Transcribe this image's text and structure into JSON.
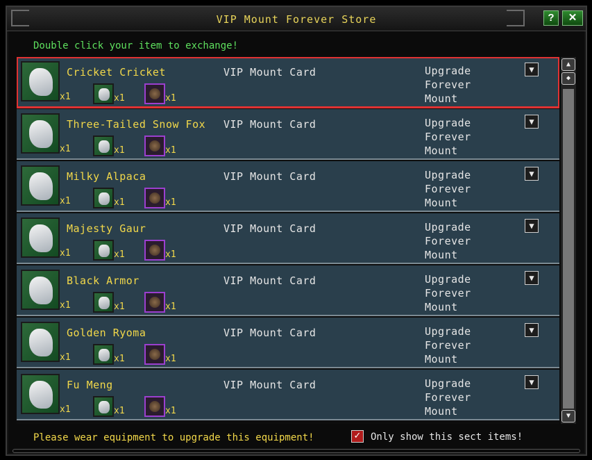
{
  "window": {
    "title": "VIP Mount Forever Store",
    "help_label": "?",
    "close_label": "✕"
  },
  "instruction": "Double click your item to exchange!",
  "rows": [
    {
      "name": "Cricket Cricket",
      "card": "VIP Mount Card",
      "action_line1": "Upgrade Forever",
      "action_line2": "Mount",
      "qty_main": "x1",
      "qty_mount": "x1",
      "qty_card": "x1",
      "selected": true
    },
    {
      "name": "Three-Tailed Snow Fox",
      "card": "VIP Mount Card",
      "action_line1": "Upgrade Forever",
      "action_line2": "Mount",
      "qty_main": "x1",
      "qty_mount": "x1",
      "qty_card": "x1"
    },
    {
      "name": "Milky Alpaca",
      "card": "VIP Mount Card",
      "action_line1": "Upgrade Forever",
      "action_line2": "Mount",
      "qty_main": "x1",
      "qty_mount": "x1",
      "qty_card": "x1"
    },
    {
      "name": "Majesty Gaur",
      "card": "VIP Mount Card",
      "action_line1": "Upgrade Forever",
      "action_line2": "Mount",
      "qty_main": "x1",
      "qty_mount": "x1",
      "qty_card": "x1"
    },
    {
      "name": "Black Armor",
      "card": "VIP Mount Card",
      "action_line1": "Upgrade Forever",
      "action_line2": "Mount",
      "qty_main": "x1",
      "qty_mount": "x1",
      "qty_card": "x1"
    },
    {
      "name": "Golden Ryoma",
      "card": "VIP Mount Card",
      "action_line1": "Upgrade Forever",
      "action_line2": "Mount",
      "qty_main": "x1",
      "qty_mount": "x1",
      "qty_card": "x1"
    },
    {
      "name": "Fu Meng",
      "card": "VIP Mount Card",
      "action_line1": "Upgrade Forever",
      "action_line2": "Mount",
      "qty_main": "x1",
      "qty_mount": "x1",
      "qty_card": "x1"
    }
  ],
  "footer": {
    "warning": "Please wear equipment to upgrade this equipment!",
    "checkbox_label": "Only show this sect items!",
    "checkbox_checked": true
  }
}
